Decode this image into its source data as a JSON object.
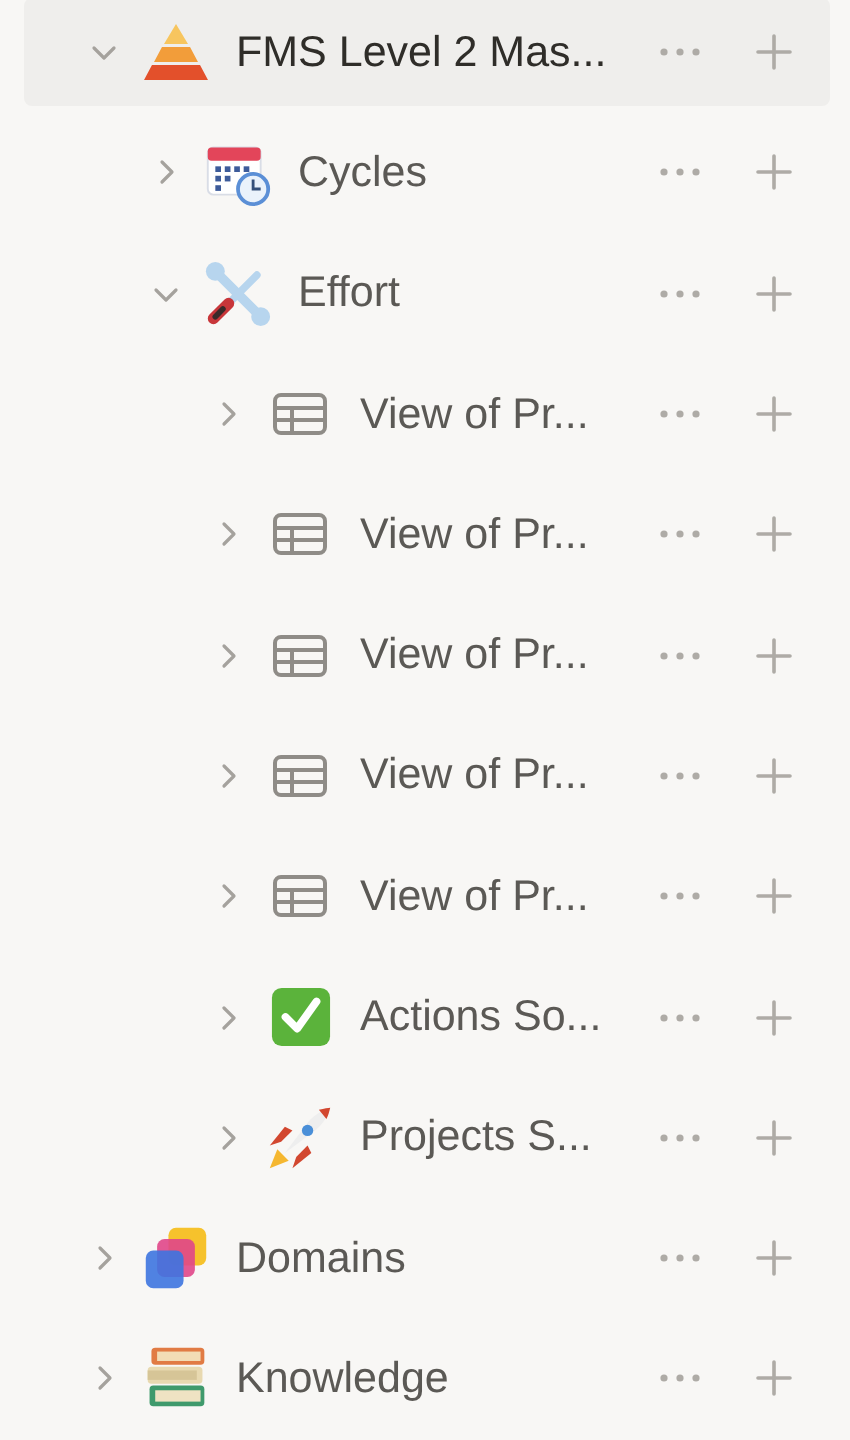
{
  "tree": [
    {
      "label": "FMS Level 2 Mas...",
      "kind": "pyramid",
      "expanded": true,
      "selected": true,
      "children": [
        {
          "label": "Cycles",
          "kind": "calendar",
          "expanded": false,
          "selected": false
        },
        {
          "label": "Effort",
          "kind": "tools",
          "expanded": true,
          "selected": false,
          "children": [
            {
              "label": "View of Pr...",
              "kind": "table",
              "expanded": false,
              "selected": false
            },
            {
              "label": "View of Pr...",
              "kind": "table",
              "expanded": false,
              "selected": false
            },
            {
              "label": "View of Pr...",
              "kind": "table",
              "expanded": false,
              "selected": false
            },
            {
              "label": "View of Pr...",
              "kind": "table",
              "expanded": false,
              "selected": false
            },
            {
              "label": "View of Pr...",
              "kind": "table",
              "expanded": false,
              "selected": false
            },
            {
              "label": "Actions So...",
              "kind": "check",
              "expanded": false,
              "selected": false
            },
            {
              "label": "Projects S...",
              "kind": "rocket",
              "expanded": false,
              "selected": false
            }
          ]
        }
      ]
    },
    {
      "label": "Domains",
      "kind": "layers",
      "expanded": false,
      "selected": false
    },
    {
      "label": "Knowledge",
      "kind": "books",
      "expanded": false,
      "selected": false
    }
  ]
}
